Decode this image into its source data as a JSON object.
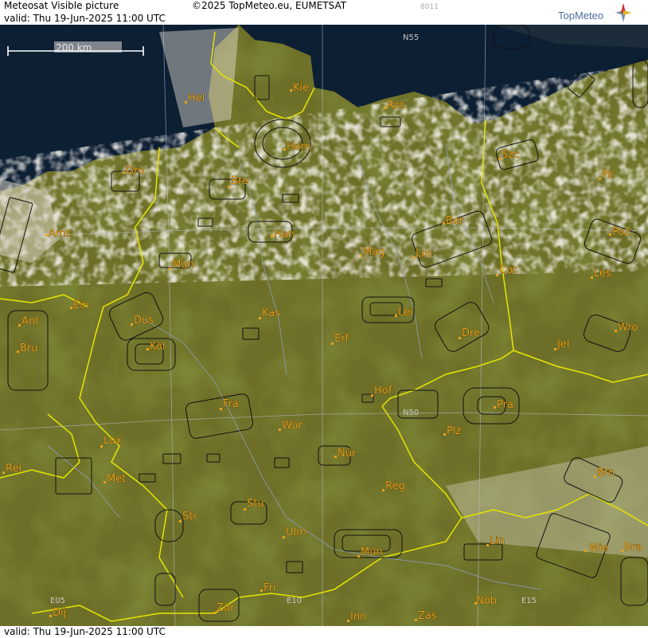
{
  "header": {
    "title": "Meteosat Visible picture",
    "copyright": "©2025 TopMeteo.eu, EUMETSAT",
    "code": "8011",
    "valid_top": "valid:  Thu  19-Jun-2025  11:00 UTC",
    "logo_text": "TopMeteo"
  },
  "footer": {
    "valid_bottom": "valid:  Thu  19-Jun-2025  11:00 UTC"
  },
  "scale": {
    "label": "200 km"
  },
  "grid_labels": {
    "n55": "N55",
    "n50": "N50",
    "e05": "E05",
    "e10": "E10",
    "e15": "E15"
  },
  "cities": {
    "hel": "Hel",
    "kie": "Kie",
    "ros": "Ros",
    "ham": "Ham",
    "szc": "Szc",
    "gro": "Gro",
    "bre": "Bre",
    "pil": "Pil",
    "ber": "Ber",
    "ams": "Ams",
    "han": "Han",
    "poz": "Poz",
    "mag": "Mag",
    "loc": "Loc",
    "mun1": "Mün",
    "cot": "Cot",
    "les": "Les",
    "ein": "Ein",
    "kas": "Kas",
    "lei": "Lei",
    "ant": "Ant",
    "dus": "Düs",
    "wro": "Wro",
    "dre": "Dre",
    "bru": "Bru",
    "kol": "Köl",
    "erf": "Erf",
    "jel": "Jel",
    "hof": "Hof",
    "fra": "Fra",
    "pra": "Pra",
    "wur": "Wür",
    "lux": "Lux",
    "plz": "Plz",
    "nur": "Nür",
    "rei": "Rei",
    "met": "Met",
    "reg": "Reg",
    "brn": "Brn",
    "stu": "Stu",
    "str": "Str",
    "ulm": "Ulm",
    "lin": "Lin",
    "mun2": "Mün",
    "wie": "Wie",
    "bra": "Bra",
    "fri": "Fri",
    "nob": "Nöb",
    "dij": "Dij",
    "zur": "Zür",
    "inn": "Inn",
    "zas": "Zas"
  },
  "colors": {
    "sea": "#0d1f33",
    "land": "#6d6f28",
    "border": "#e6e600",
    "city": "#e8a21c",
    "cloud": "#e9e3d6"
  }
}
